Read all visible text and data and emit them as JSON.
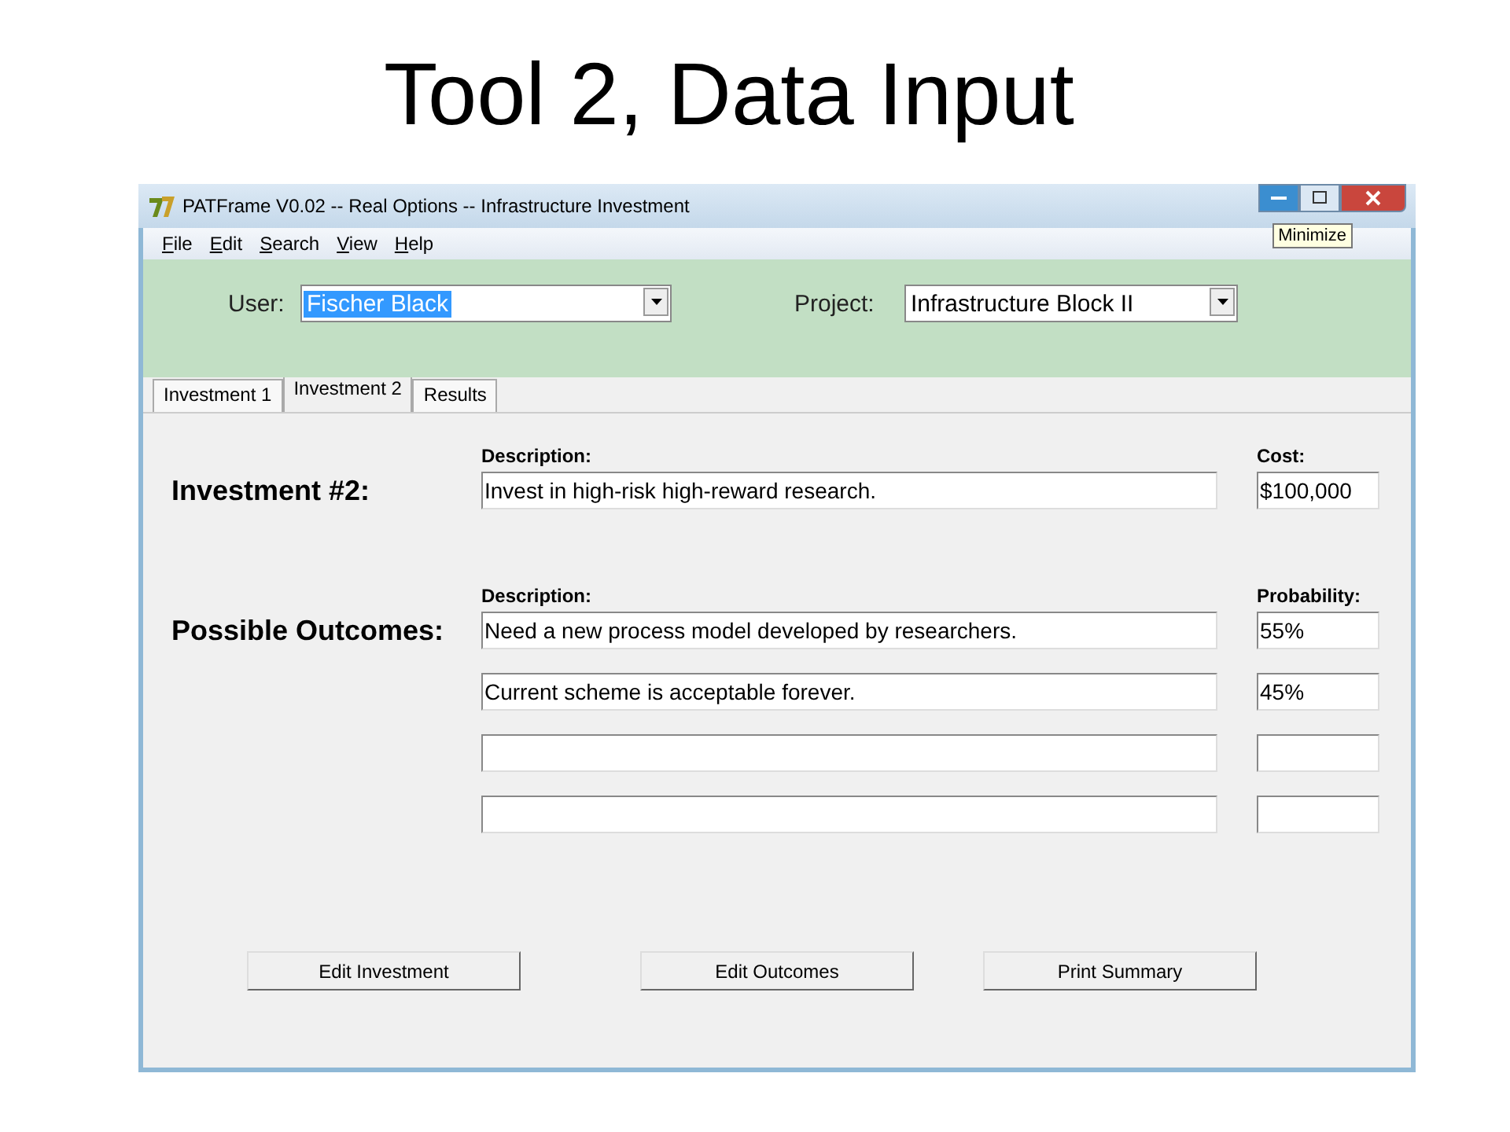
{
  "slide_title": "Tool 2, Data Input",
  "window": {
    "title": "PATFrame V0.02  -- Real Options -- Infrastructure Investment",
    "tooltip": "Minimize"
  },
  "menu": [
    "File",
    "Edit",
    "Search",
    "View",
    "Help"
  ],
  "user": {
    "label": "User:",
    "value": "Fischer Black",
    "highlighted": true
  },
  "project": {
    "label": "Project:",
    "value": "Infrastructure Block II"
  },
  "tabs": [
    {
      "label": "Investment 1",
      "selected": false
    },
    {
      "label": "Investment 2",
      "selected": true
    },
    {
      "label": "Results",
      "selected": false
    }
  ],
  "investment": {
    "label": "Investment #2:",
    "description_header": "Description:",
    "cost_header": "Cost:",
    "description": "Invest in high-risk high-reward research.",
    "cost": "$100,000"
  },
  "outcomes": {
    "label": "Possible Outcomes:",
    "description_header": "Description:",
    "probability_header": "Probability:",
    "rows": [
      {
        "description": "Need a new process model developed by researchers.",
        "probability": "55%"
      },
      {
        "description": "Current scheme is acceptable forever.",
        "probability": "45%"
      },
      {},
      {}
    ]
  },
  "buttons": [
    "Edit Investment",
    "Edit Outcomes",
    "Print Summary"
  ]
}
